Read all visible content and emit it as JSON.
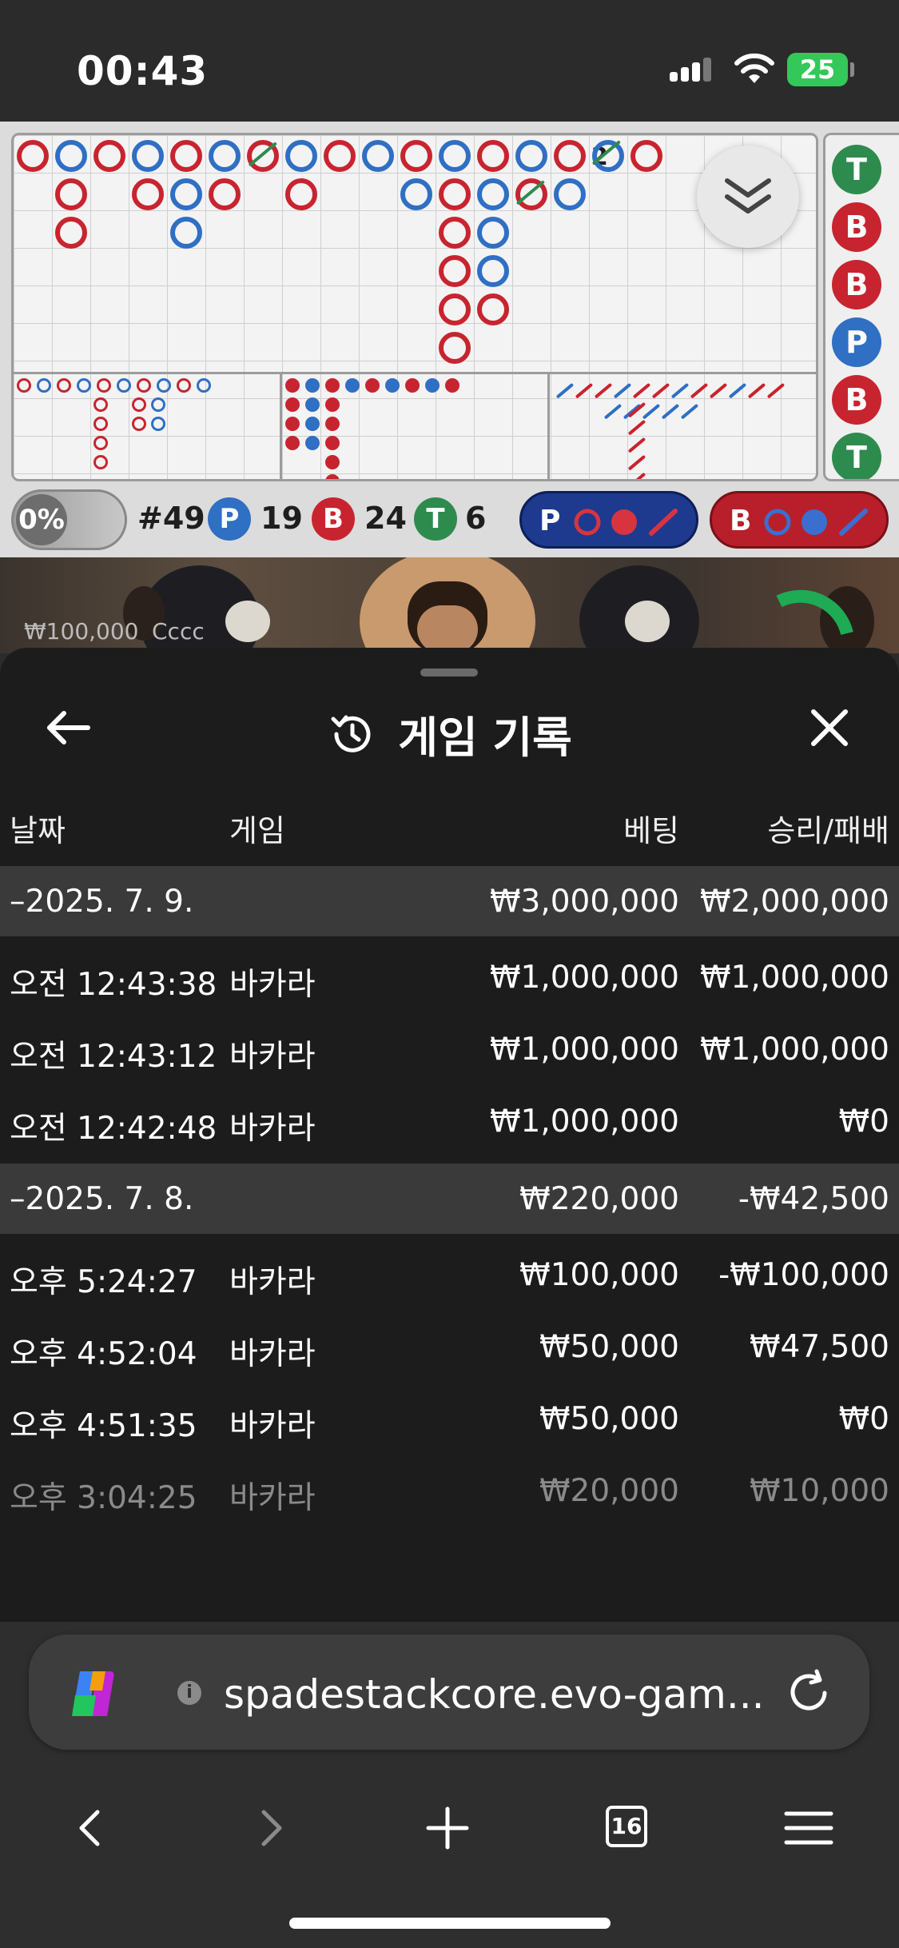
{
  "status_bar": {
    "time": "00:43",
    "battery": "25"
  },
  "scoreboard": {
    "percent": "0%",
    "round": "#49",
    "player_count": "19",
    "banker_count": "24",
    "tie_count": "6",
    "player_letter": "P",
    "banker_letter": "B",
    "tie_letter": "T",
    "player_predict": "P",
    "banker_predict": "B",
    "bead_labels": [
      "T",
      "B",
      "B",
      "P",
      "B",
      "T"
    ],
    "bead_colors": [
      "#2e8b4e",
      "#c8242f",
      "#c8242f",
      "#2f6fc4",
      "#c8242f",
      "#2e8b4e"
    ],
    "big_road_tie_label": "2",
    "colors": {
      "player": "#2f6fc4",
      "banker": "#c8242f",
      "tie": "#2e8b4e"
    }
  },
  "video": {
    "balance": "₩100,000",
    "player_name": "Cccc"
  },
  "panel": {
    "title": "게임 기록",
    "columns": {
      "date": "날짜",
      "game": "게임",
      "bet": "베팅",
      "result": "승리/패배"
    },
    "groups": [
      {
        "date": "–2025. 7. 9.",
        "bet_total": "₩3,000,000",
        "result_total": "₩2,000,000",
        "rows": [
          {
            "time": "오전 12:43:38",
            "game": "바카라",
            "bet": "₩1,000,000",
            "result": "₩1,000,000"
          },
          {
            "time": "오전 12:43:12",
            "game": "바카라",
            "bet": "₩1,000,000",
            "result": "₩1,000,000"
          },
          {
            "time": "오전 12:42:48",
            "game": "바카라",
            "bet": "₩1,000,000",
            "result": "₩0"
          }
        ]
      },
      {
        "date": "–2025. 7. 8.",
        "bet_total": "₩220,000",
        "result_total": "-₩42,500",
        "rows": [
          {
            "time": "오후 5:24:27",
            "game": "바카라",
            "bet": "₩100,000",
            "result": "-₩100,000"
          },
          {
            "time": "오후 4:52:04",
            "game": "바카라",
            "bet": "₩50,000",
            "result": "₩47,500"
          },
          {
            "time": "오후 4:51:35",
            "game": "바카라",
            "bet": "₩50,000",
            "result": "₩0"
          },
          {
            "time": "오후 3:04:25",
            "game": "바카라",
            "bet": "₩20,000",
            "result": "₩10,000"
          }
        ]
      }
    ]
  },
  "browser": {
    "url": "spadestackcore.evo-gam...",
    "tab_count": "16"
  }
}
